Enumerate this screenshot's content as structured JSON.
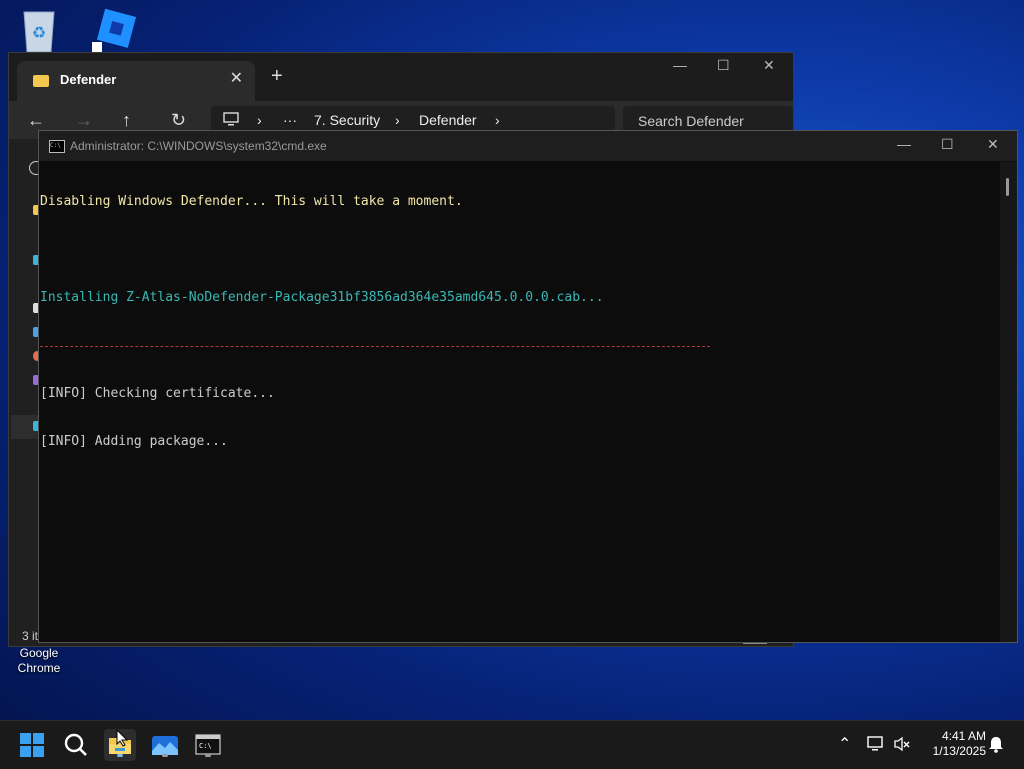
{
  "desktop": {
    "chrome_label_line1": "Google",
    "chrome_label_line2": "Chrome"
  },
  "explorer": {
    "tab_title": "Defender",
    "tab_close": "✕",
    "new_tab": "+",
    "breadcrumb": [
      "7. Security",
      "Defender"
    ],
    "breadcrumb_more": "···",
    "search_placeholder": "Search Defender",
    "status_text": "3 it"
  },
  "cmd": {
    "title": "Administrator: C:\\WINDOWS\\system32\\cmd.exe",
    "lines": {
      "l1": "Disabling Windows Defender... This will take a moment.",
      "l2": "Installing Z-Atlas-NoDefender-Package31bf3856ad364e35amd645.0.0.0.cab...",
      "l3": "[INFO] Checking certificate...",
      "l4": "[INFO] Adding package..."
    }
  },
  "taskbar": {
    "time": "4:41 AM",
    "date": "1/13/2025"
  },
  "colors": {
    "console_yellow": "#f0e6a8",
    "console_cyan": "#3ab7b4",
    "divider_red": "#b03a3a"
  }
}
